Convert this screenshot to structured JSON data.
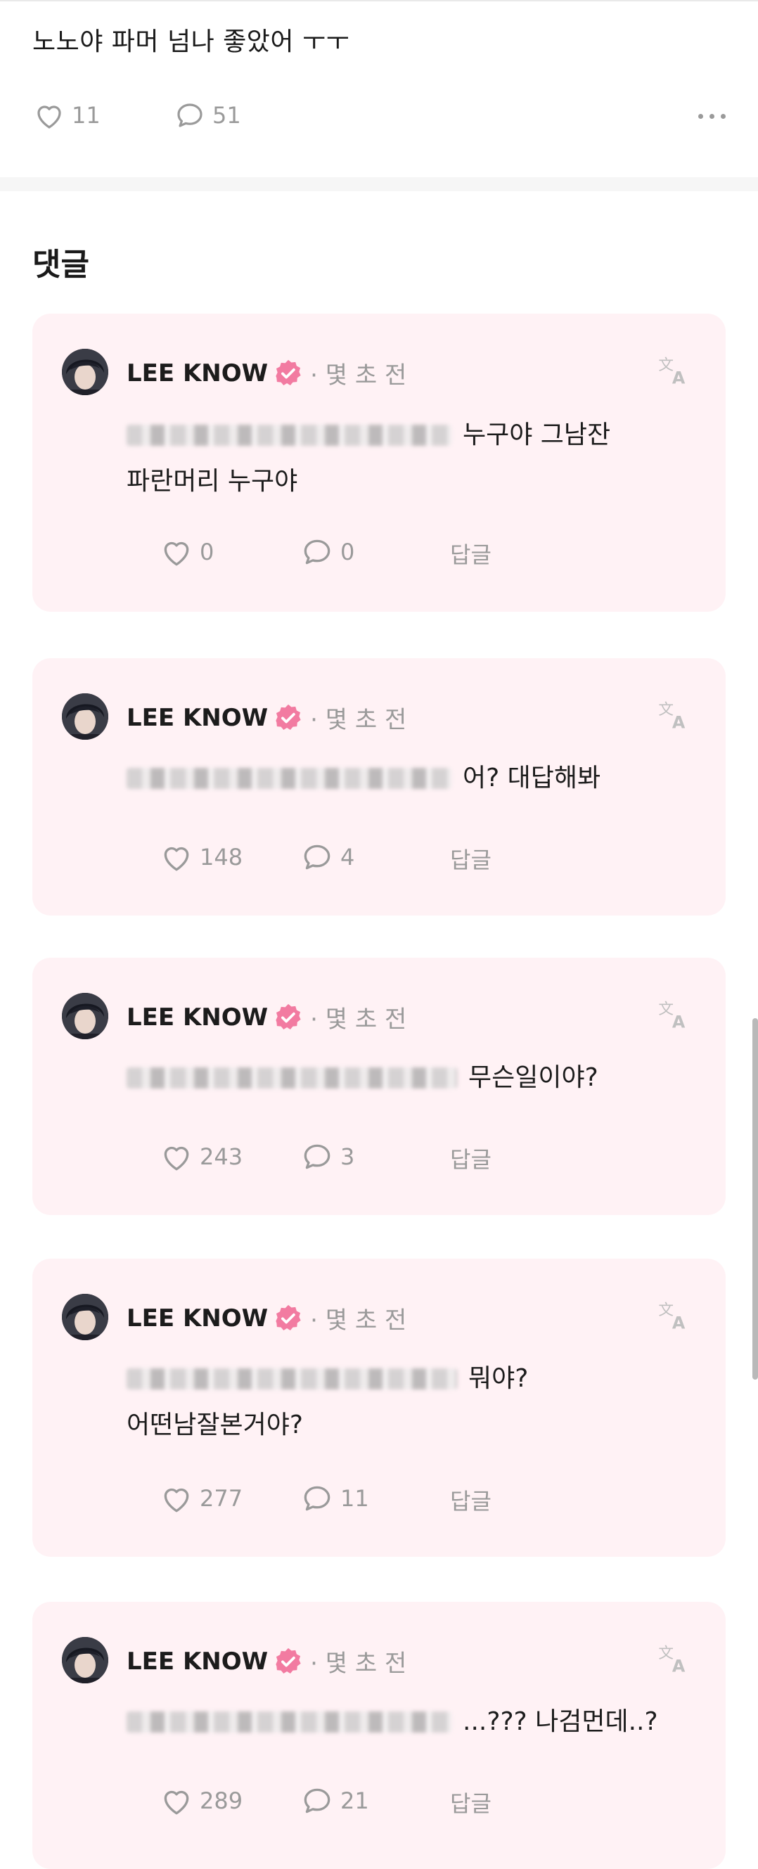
{
  "post": {
    "text": "노노야 파머 넘나 좋았어 ㅜㅜ",
    "likes": "11",
    "comments": "51"
  },
  "section_title": "댓글",
  "colors": {
    "card_bg": "#fff2f5",
    "badge": "#f27ba1",
    "muted": "#9a9a9a"
  },
  "comments": [
    {
      "author": "LEE KNOW",
      "time": "· 몇 초 전",
      "text_line1": "누구야 그남잔",
      "text_line2": "파란머리 누구야",
      "likes": "0",
      "replies": "0",
      "reply_label": "답글"
    },
    {
      "author": "LEE KNOW",
      "time": "· 몇 초 전",
      "text_line1": "어? 대답해봐",
      "likes": "148",
      "replies": "4",
      "reply_label": "답글"
    },
    {
      "author": "LEE KNOW",
      "time": "· 몇 초 전",
      "text_line1": "무슨일이야?",
      "likes": "243",
      "replies": "3",
      "reply_label": "답글"
    },
    {
      "author": "LEE KNOW",
      "time": "· 몇 초 전",
      "text_line1": "뭐야?",
      "text_line2": "어떤남잘본거야?",
      "likes": "277",
      "replies": "11",
      "reply_label": "답글"
    },
    {
      "author": "LEE KNOW",
      "time": "· 몇 초 전",
      "text_line1": "...??? 나검먼데..?",
      "likes": "289",
      "replies": "21",
      "reply_label": "답글"
    }
  ]
}
